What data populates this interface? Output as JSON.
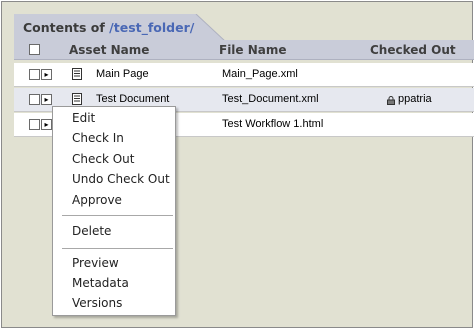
{
  "title": {
    "prefix": "Contents of",
    "path": "/test_folder/"
  },
  "columns": {
    "asset": "Asset Name",
    "file": "File Name",
    "checked": "Checked Out"
  },
  "rows": [
    {
      "asset": "Main Page",
      "file": "Main_Page.xml",
      "checked": ""
    },
    {
      "asset": "Test Document",
      "file": "Test_Document.xml",
      "checked": "ppatria"
    },
    {
      "asset": "",
      "file": "Test Workflow 1.html",
      "checked": ""
    }
  ],
  "menu": {
    "edit": "Edit",
    "check_in": "Check In",
    "check_out": "Check Out",
    "undo_check_out": "Undo Check Out",
    "approve": "Approve",
    "delete": "Delete",
    "preview": "Preview",
    "metadata": "Metadata",
    "versions": "Versions"
  },
  "icons": {
    "expand": "expand-arrow-icon",
    "document": "document-icon",
    "lock": "lock-icon"
  },
  "colors": {
    "path": "#4a68b5",
    "header": "#c9ccd9",
    "panel": "#e1e1d2"
  }
}
